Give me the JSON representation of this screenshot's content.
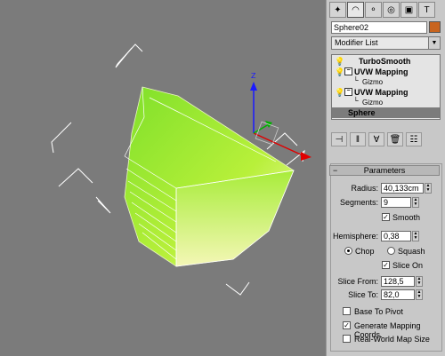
{
  "object_name": "Sphere02",
  "object_color": "#c8641e",
  "modifier_list": "Modifier List",
  "stack": [
    {
      "label": "TurboSmooth",
      "type": "modifier"
    },
    {
      "label": "UVW Mapping",
      "type": "modifier",
      "expandable": true
    },
    {
      "label": "Gizmo",
      "type": "sub"
    },
    {
      "label": "UVW Mapping",
      "type": "modifier",
      "expandable": true
    },
    {
      "label": "Gizmo",
      "type": "sub"
    },
    {
      "label": "Sphere",
      "type": "base",
      "selected": true
    }
  ],
  "rollout_title": "Parameters",
  "params": {
    "radius_label": "Radius:",
    "radius_value": "40,133cm",
    "segments_label": "Segments:",
    "segments_value": "9",
    "smooth_label": "Smooth",
    "smooth_checked": true,
    "hemisphere_label": "Hemisphere:",
    "hemisphere_value": "0,38",
    "chop_label": "Chop",
    "squash_label": "Squash",
    "chop_selected": true,
    "slice_on_label": "Slice On",
    "slice_on_checked": true,
    "slice_from_label": "Slice From:",
    "slice_from_value": "128,5",
    "slice_to_label": "Slice To:",
    "slice_to_value": "82,0",
    "base_to_pivot_label": "Base To Pivot",
    "base_to_pivot_checked": false,
    "gen_mapping_label": "Generate Mapping Coords.",
    "gen_mapping_checked": true,
    "real_world_label": "Real-World Map Size",
    "real_world_checked": false
  },
  "gizmo_axis_label": "Z"
}
